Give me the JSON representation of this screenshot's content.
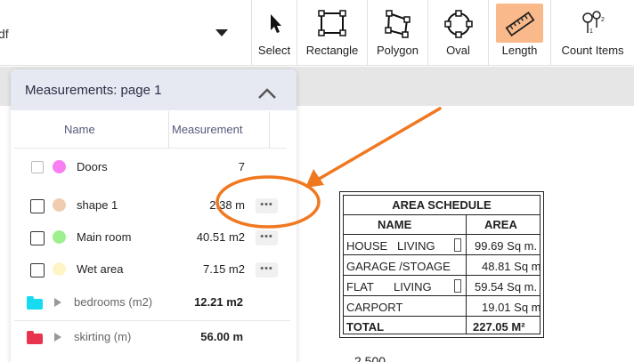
{
  "toolbar": {
    "file_name": "df",
    "tools": [
      {
        "label": "Select",
        "icon": "cursor-icon"
      },
      {
        "label": "Rectangle",
        "icon": "rectangle-icon"
      },
      {
        "label": "Polygon",
        "icon": "polygon-icon"
      },
      {
        "label": "Oval",
        "icon": "oval-icon"
      },
      {
        "label": "Length",
        "icon": "ruler-icon",
        "active": true
      },
      {
        "label": "Count Items",
        "icon": "count-pins-icon"
      }
    ],
    "active_color": "#f9b98a"
  },
  "panel": {
    "title": "Measurements: page 1",
    "columns": {
      "name": "Name",
      "measurement": "Measurement"
    },
    "rows": [
      {
        "name": "Doors",
        "value": "7",
        "color": "#f77ff2"
      },
      {
        "name": "shape 1",
        "value": "2.38 m",
        "color": "#f0cdb0"
      },
      {
        "name": "Main room",
        "value": "40.51 m2",
        "color": "#9ef08f"
      },
      {
        "name": "Wet area",
        "value": "7.15 m2",
        "color": "#fdf5c5"
      }
    ],
    "groups": [
      {
        "name": "bedrooms (m2)",
        "value": "12.21 m2",
        "color": "#17dbf0"
      },
      {
        "name": "skirting (m)",
        "value": "56.00 m",
        "color": "#e8344e"
      }
    ]
  },
  "schedule": {
    "title": "AREA SCHEDULE",
    "col_name": "NAME",
    "col_area": "AREA",
    "rows": [
      {
        "name": "HOUSE",
        "sub": "LIVING",
        "area": "99.69 Sq m."
      },
      {
        "name": "GARAGE /STOAGE",
        "sub": "",
        "area": "48.81 Sq m"
      },
      {
        "name": "FLAT",
        "sub": "LIVING",
        "area": "59.54 Sq m."
      },
      {
        "name": "CARPORT",
        "sub": "",
        "area": "19.01 Sq m"
      }
    ],
    "total_label": "TOTAL",
    "total_value": "227.05  M²"
  },
  "partial_text": "2 500",
  "annotation_color": "#f07820"
}
